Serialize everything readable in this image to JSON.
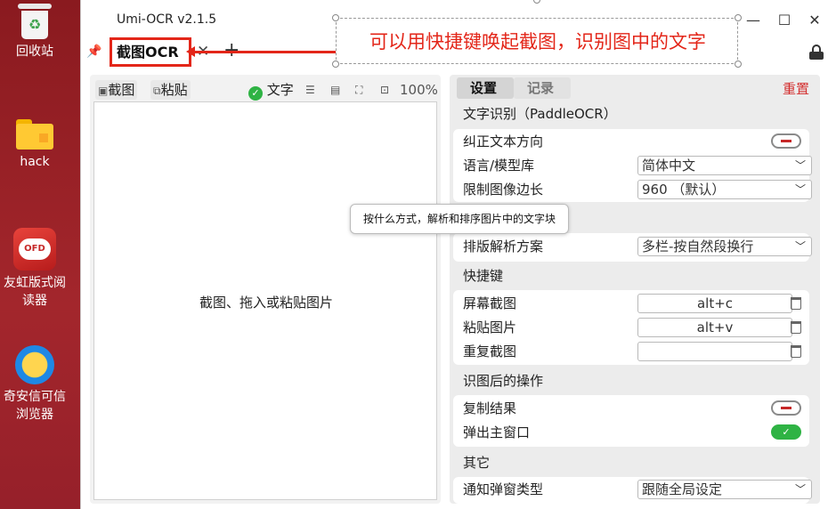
{
  "desktop": {
    "icons": [
      {
        "label": "回收站",
        "icon": "recycle-bin-icon"
      },
      {
        "label": "hack",
        "icon": "folder-icon"
      },
      {
        "label": "友虹版式阅读器",
        "icon": "ofd-reader-icon"
      },
      {
        "label": "奇安信可信浏览器",
        "icon": "qianxin-browser-icon"
      }
    ]
  },
  "window": {
    "title": "Umi-OCR v2.1.5",
    "controls": {
      "minimize": "—",
      "maximize": "☐",
      "close": "✕"
    }
  },
  "tabs": {
    "active_label": "截图OCR",
    "close_glyph": "✕",
    "add_glyph": "+"
  },
  "annotation": {
    "text": "可以用快捷键唤起截图，识别图中的文字",
    "color": "#e32619"
  },
  "left_panel": {
    "toolbar": {
      "screenshot": "截图",
      "paste": "粘贴",
      "text_toggle": "文字",
      "zoom": "100%"
    },
    "canvas_hint": "截图、拖入或粘贴图片"
  },
  "tooltip": "按什么方式，解析和排序图片中的文字块",
  "right_panel": {
    "tabs": [
      "设置",
      "记录"
    ],
    "reset": "重置",
    "section_ocr": "文字识别（PaddleOCR）",
    "correct_direction": "纠正文本方向",
    "language_label": "语言/模型库",
    "language_value": "简体中文",
    "limit_label": "限制图像边长",
    "limit_value": "960 （默认）",
    "layout_label": "排版解析方案",
    "layout_value": "多栏-按自然段换行",
    "section_hotkeys": "快捷键",
    "hotkey_screenshot_label": "屏幕截图",
    "hotkey_screenshot_value": "alt+c",
    "hotkey_paste_label": "粘贴图片",
    "hotkey_paste_value": "alt+v",
    "hotkey_repeat_label": "重复截图",
    "hotkey_repeat_value": "",
    "section_after": "识图后的操作",
    "copy_result": "复制结果",
    "popup_main": "弹出主窗口",
    "section_other": "其它",
    "notify_label": "通知弹窗类型",
    "notify_value": "跟随全局设定"
  }
}
